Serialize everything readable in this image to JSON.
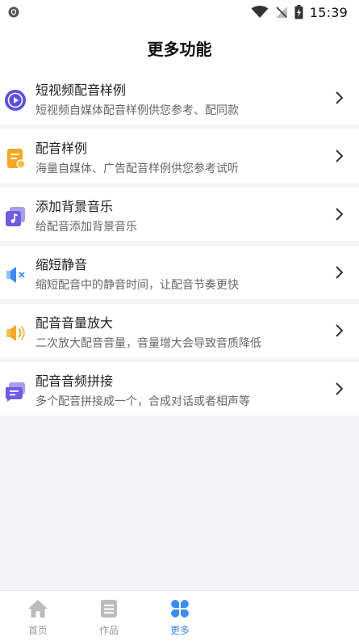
{
  "status_bar": {
    "time": "15:39"
  },
  "header": {
    "title": "更多功能"
  },
  "items": [
    {
      "title": "短视频配音样例",
      "subtitle": "短视频自媒体配音样例供您参考、配同款",
      "icon": "play-circle-icon"
    },
    {
      "title": "配音样例",
      "subtitle": "海量自媒体、广告配音样例供您参考试听",
      "icon": "document-star-icon"
    },
    {
      "title": "添加背景音乐",
      "subtitle": "给配音添加背景音乐",
      "icon": "music-note-icon"
    },
    {
      "title": "缩短静音",
      "subtitle": "缩短配音中的静音时间，让配音节奏更快",
      "icon": "speaker-mute-icon"
    },
    {
      "title": "配音音量放大",
      "subtitle": "二次放大配音音量，音量增大会导致音质降低",
      "icon": "speaker-loud-icon"
    },
    {
      "title": "配音音频拼接",
      "subtitle": "多个配音拼接成一个，合成对话或者相声等",
      "icon": "chat-bubble-icon"
    }
  ],
  "bottom_nav": {
    "items": [
      {
        "label": "首页",
        "icon": "home-icon",
        "active": false
      },
      {
        "label": "作品",
        "icon": "list-icon",
        "active": false
      },
      {
        "label": "更多",
        "icon": "grid-petals-icon",
        "active": true
      }
    ]
  },
  "colors": {
    "accent": "#3a8df5",
    "inactive": "#999999"
  }
}
